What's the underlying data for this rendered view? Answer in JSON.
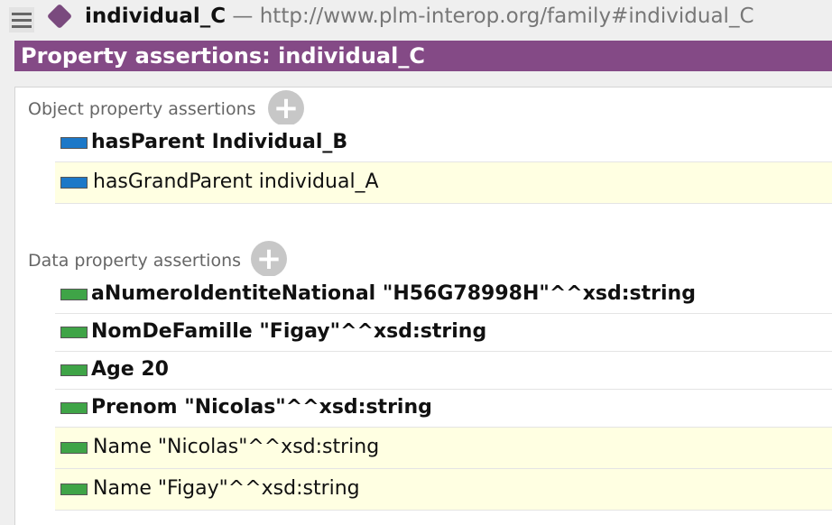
{
  "header": {
    "individual_name": "individual_C",
    "separator": " — ",
    "iri": "http://www.plm-interop.org/family#individual_C"
  },
  "view": {
    "title": "Property assertions: individual_C"
  },
  "object_properties": {
    "label": "Object property assertions",
    "add_symbol": "+",
    "rows": [
      {
        "text": "hasParent  Individual_B",
        "kind": "asserted"
      },
      {
        "text": "hasGrandParent  individual_A",
        "kind": "inferred"
      }
    ]
  },
  "data_properties": {
    "label": "Data property assertions",
    "add_symbol": "+",
    "rows": [
      {
        "text": "aNumeroIdentiteNational  \"H56G78998H\"^^xsd:string",
        "kind": "asserted"
      },
      {
        "text": "NomDeFamille  \"Figay\"^^xsd:string",
        "kind": "asserted"
      },
      {
        "text": "Age  20",
        "kind": "asserted"
      },
      {
        "text": "Prenom  \"Nicolas\"^^xsd:string",
        "kind": "asserted"
      },
      {
        "text": "Name  \"Nicolas\"^^xsd:string",
        "kind": "inferred"
      },
      {
        "text": "Name  \"Figay\"^^xsd:string",
        "kind": "inferred"
      }
    ]
  },
  "colors": {
    "header_bar": "#844a86",
    "object_property": "#1c78c8",
    "data_property": "#3fa447",
    "inferred_row": "#ffffe2"
  }
}
